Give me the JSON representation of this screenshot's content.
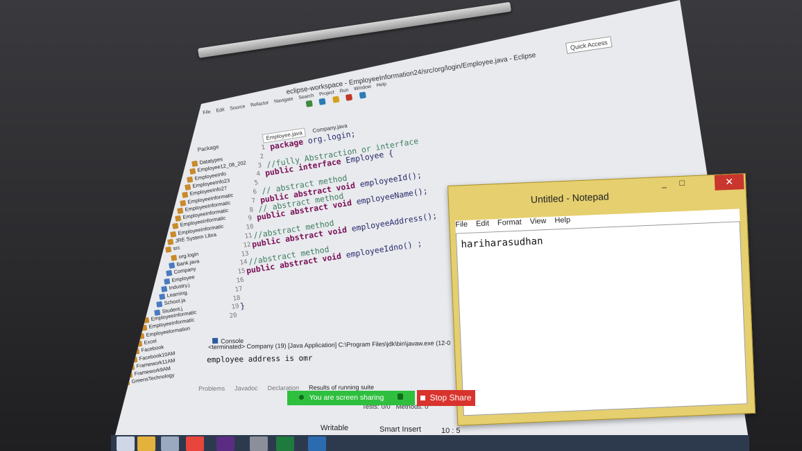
{
  "eclipse": {
    "title": "eclipse-workspace - EmployeeInformation24/src/org/login/Employee.java - Eclipse",
    "menu": [
      "File",
      "Edit",
      "Source",
      "Refactor",
      "Navigate",
      "Search",
      "Project",
      "Run",
      "Window",
      "Help"
    ],
    "quick_access": "Quick Access",
    "tabs": [
      "Employee.java",
      "Company.java"
    ],
    "package_explorer_label": "Package",
    "tree": [
      "Datatypes",
      "Employee12_08_202",
      "EmployeeInfo",
      "EmployeeInfo23",
      "EmployeeInfo27",
      "EmployeeInformatic",
      "EmployeeInformatic",
      "EmployeeInformatic",
      "EmployeeInformatic",
      "EmployeeInformatic",
      "JRE System Libra",
      "src",
      "org.login",
      "Bank.java",
      "Company",
      "Employee",
      "Industry.j",
      "Learning.",
      "School.ja",
      "Student.j",
      "EmployeeInformatic",
      "EmployeeInformatic",
      "Employeelormation",
      "Excel",
      "Facebook",
      "Facebook10AM",
      "Framework11AM",
      "Framework9AM",
      "GreensTechnology"
    ],
    "code_lines": [
      {
        "n": "1",
        "parts": [
          {
            "t": "package ",
            "c": "kw"
          },
          {
            "t": "org.login;",
            "c": ""
          }
        ]
      },
      {
        "n": "2",
        "parts": []
      },
      {
        "n": "3",
        "parts": [
          {
            "t": "//fully Abstraction or interface",
            "c": "cm"
          }
        ]
      },
      {
        "n": "4",
        "parts": [
          {
            "t": "public interface ",
            "c": "kw"
          },
          {
            "t": "Employee  {",
            "c": ""
          }
        ]
      },
      {
        "n": "5",
        "parts": []
      },
      {
        "n": "6",
        "parts": [
          {
            "t": "    // abstract method",
            "c": "cm"
          }
        ]
      },
      {
        "n": "7",
        "parts": [
          {
            "t": "    public abstract void ",
            "c": "kw"
          },
          {
            "t": "employeeId();",
            "c": ""
          }
        ]
      },
      {
        "n": "8",
        "parts": [
          {
            "t": "    // abstract method",
            "c": "cm"
          }
        ]
      },
      {
        "n": "9",
        "parts": [
          {
            "t": "    public abstract  void ",
            "c": "kw"
          },
          {
            "t": "employeeName();",
            "c": ""
          }
        ]
      },
      {
        "n": "10",
        "parts": []
      },
      {
        "n": "11",
        "parts": [
          {
            "t": "    //abstract method",
            "c": "cm"
          }
        ]
      },
      {
        "n": "12",
        "parts": [
          {
            "t": "    public abstract void ",
            "c": "kw"
          },
          {
            "t": "employeeAddress();",
            "c": ""
          }
        ]
      },
      {
        "n": "13",
        "parts": []
      },
      {
        "n": "14",
        "parts": [
          {
            "t": "    //abstract method",
            "c": "cm"
          }
        ]
      },
      {
        "n": "15",
        "parts": [
          {
            "t": "    public abstract void ",
            "c": "kw"
          },
          {
            "t": "employeeIdno() ;",
            "c": ""
          }
        ]
      },
      {
        "n": "16",
        "parts": []
      },
      {
        "n": "17",
        "parts": []
      },
      {
        "n": "18",
        "parts": []
      },
      {
        "n": "19",
        "parts": [
          {
            "t": "}",
            "c": ""
          }
        ]
      },
      {
        "n": "20",
        "parts": []
      }
    ],
    "console": {
      "tab": "Console",
      "header": "<terminated> Company (19) [Java Application] C:\\Program Files\\jdk\\bin\\javaw.exe (12-0",
      "output": "employee address is omr"
    },
    "bottom_tabs": [
      "Problems",
      "Javadoc",
      "Declaration",
      "Results of running suite"
    ],
    "tests_label": "Tests: 0/0",
    "methods_label": "Methods: 0",
    "status": {
      "writable": "Writable",
      "insert": "Smart Insert",
      "position": "10 : 5"
    }
  },
  "notepad": {
    "title": "Untitled - Notepad",
    "menu": [
      "File",
      "Edit",
      "Format",
      "View",
      "Help"
    ],
    "content": "hariharasudhan"
  },
  "sharing": {
    "banner": "You are screen sharing",
    "stop": "Stop Share",
    "accent_green": "#2fbf3f",
    "accent_red": "#d8332d"
  }
}
